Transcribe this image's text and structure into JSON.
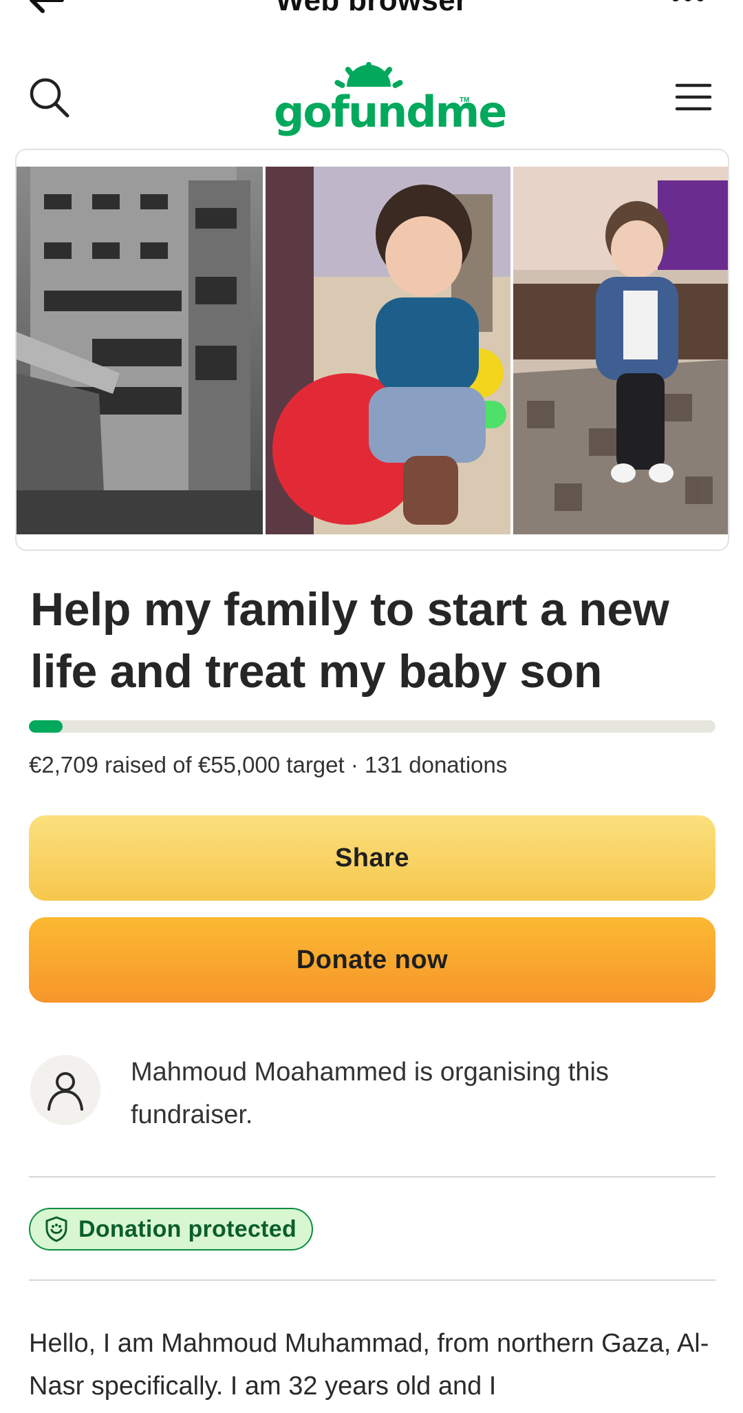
{
  "browser_bar": {
    "title": "Web browser"
  },
  "header": {
    "brand": "gofundme",
    "trademark": "TM"
  },
  "gallery": {
    "photos": [
      {
        "subject": "bombed-building-photo"
      },
      {
        "subject": "toddler-on-ride-photo"
      },
      {
        "subject": "child-standing-photo"
      }
    ]
  },
  "campaign": {
    "title": "Help my family to start a new life and treat my baby son",
    "progress_fraction": 0.049,
    "stats": "€2,709 raised of €55,000 target · 131 donations"
  },
  "actions": {
    "share_label": "Share",
    "donate_label": "Donate now"
  },
  "organiser": {
    "text": "Mahmoud Moahammed is organising this fundraiser."
  },
  "badge": {
    "label": "Donation protected"
  },
  "story": {
    "text": "Hello, I am Mahmoud Muhammad, from northern Gaza, Al-Nasr specifically. I am 32 years old and I"
  },
  "colors": {
    "brand_green": "#02a95c",
    "share_yellow": "#f7c74c",
    "donate_orange": "#f7962b",
    "badge_bg": "#d8f7d0"
  }
}
